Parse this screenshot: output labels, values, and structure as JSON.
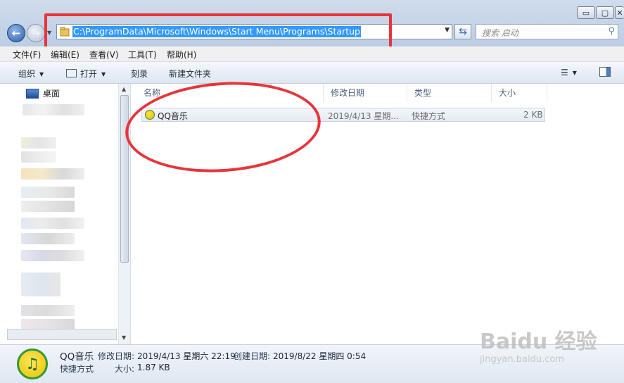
{
  "address_bar": {
    "path": "C:\\ProgramData\\Microsoft\\Windows\\Start Menu\\Programs\\Startup"
  },
  "search": {
    "placeholder": "搜索 启动"
  },
  "window_controls": {
    "minimize": "▭",
    "maximize": "▢",
    "close": "✕"
  },
  "menu": {
    "items": [
      "文件(F)",
      "编辑(E)",
      "查看(V)",
      "工具(T)",
      "帮助(H)"
    ]
  },
  "toolbar": {
    "organize": "组织",
    "open": "打开",
    "burn": "刻录",
    "new_folder": "新建文件夹"
  },
  "sidebar": {
    "desktop": "桌面"
  },
  "columns": {
    "name": "名称",
    "modified": "修改日期",
    "type": "类型",
    "size": "大小"
  },
  "files": [
    {
      "name": "QQ音乐",
      "modified": "2019/4/13 星期...",
      "type": "快捷方式",
      "size": "2 KB"
    }
  ],
  "details": {
    "name": "QQ音乐",
    "modified_label": "修改日期:",
    "modified": "2019/4/13 星期六 22:19",
    "created_label": "创建日期:",
    "created": "2019/8/22 星期四 0:54",
    "type": "快捷方式",
    "size_label": "大小:",
    "size": "1.87 KB"
  },
  "watermark": {
    "brand": "Baidu 经验",
    "url": "jingyan.baidu.com"
  },
  "colors": {
    "annotation": "#e8343a",
    "selection": "#3399ff"
  },
  "icons": {
    "back": "back-arrow-icon",
    "forward": "forward-arrow-icon",
    "folder": "folder-icon",
    "refresh": "refresh-icon",
    "search": "search-icon",
    "app": "qq-music-icon"
  }
}
